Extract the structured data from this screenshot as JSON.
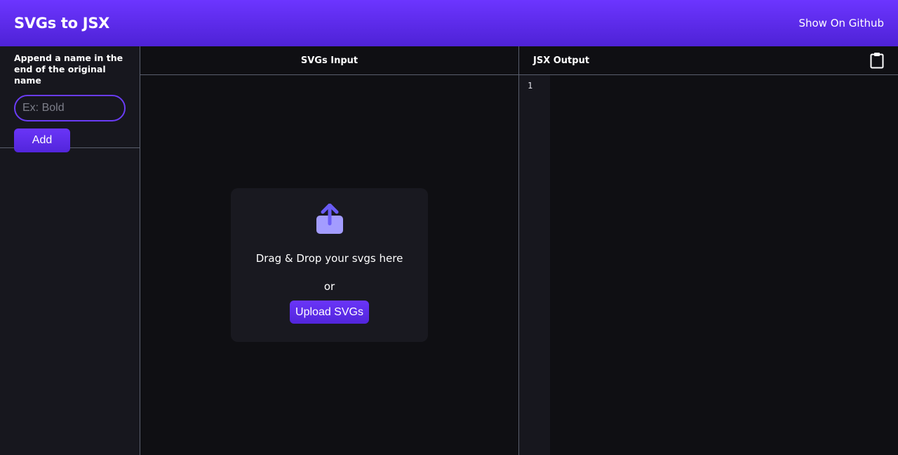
{
  "header": {
    "title": "SVGs to JSX",
    "github_link": "Show On Github"
  },
  "sidebar": {
    "label": "Append a name in the end of the original name",
    "input_placeholder": "Ex: Bold",
    "input_value": "",
    "add_button": "Add"
  },
  "input_panel": {
    "title": "SVGs Input",
    "drop_text": "Drag & Drop your svgs here",
    "or_text": "or",
    "upload_button": "Upload SVGs",
    "upload_icon": "upload-icon"
  },
  "output_panel": {
    "title": "JSX Output",
    "copy_icon": "clipboard-icon",
    "line_numbers": [
      "1"
    ]
  },
  "colors": {
    "accent": "#6a35f8",
    "header_gradient_start": "#6c35ff",
    "header_gradient_end": "#4e22d6",
    "background": "#0f0f13",
    "panel": "#17171e",
    "icon_light": "#a39cff",
    "icon_dark": "#6a5cf5"
  }
}
